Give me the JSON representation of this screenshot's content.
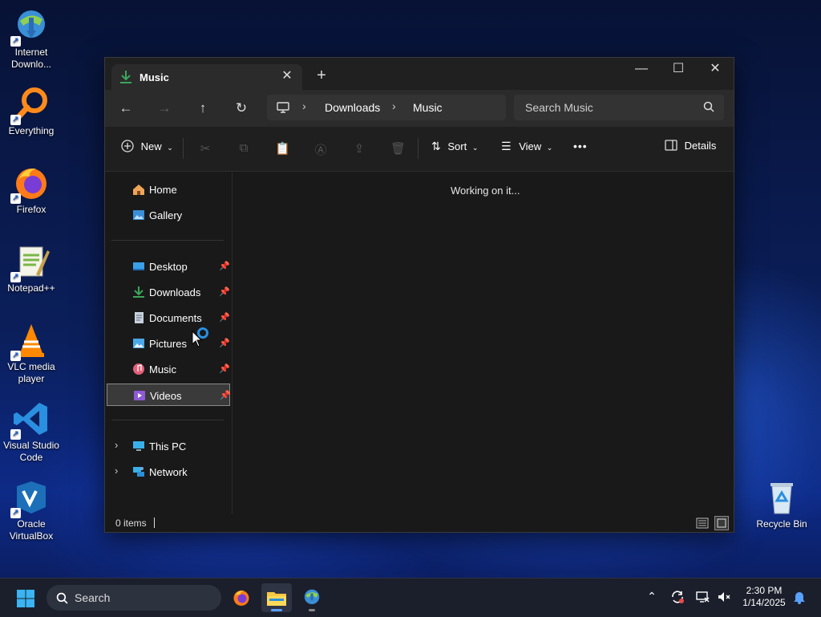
{
  "desktop": {
    "icons": [
      {
        "label": "Internet Downlo...",
        "icon": "idm-icon"
      },
      {
        "label": "Everything",
        "icon": "everything-icon"
      },
      {
        "label": "Firefox",
        "icon": "firefox-icon"
      },
      {
        "label": "Notepad++",
        "icon": "notepadpp-icon"
      },
      {
        "label": "VLC media player",
        "icon": "vlc-icon"
      },
      {
        "label": "Visual Studio Code",
        "icon": "vscode-icon"
      },
      {
        "label": "Oracle VirtualBox",
        "icon": "virtualbox-icon"
      },
      {
        "label": "Recycle Bin",
        "icon": "recycle-bin-icon"
      }
    ]
  },
  "window": {
    "tab_title": "Music",
    "new_tab_symbol": "+",
    "breadcrumb": [
      "Downloads",
      "Music"
    ],
    "search_placeholder": "Search Music",
    "toolbar": {
      "new_label": "New",
      "sort_label": "Sort",
      "view_label": "View",
      "more_label": "•••",
      "details_label": "Details"
    },
    "sidebar": {
      "top": [
        {
          "label": "Home",
          "icon": "home-icon"
        },
        {
          "label": "Gallery",
          "icon": "gallery-icon"
        }
      ],
      "pinned": [
        {
          "label": "Desktop",
          "icon": "desktop-folder-icon"
        },
        {
          "label": "Downloads",
          "icon": "downloads-folder-icon"
        },
        {
          "label": "Documents",
          "icon": "documents-folder-icon"
        },
        {
          "label": "Pictures",
          "icon": "pictures-folder-icon"
        },
        {
          "label": "Music",
          "icon": "music-folder-icon"
        },
        {
          "label": "Videos",
          "icon": "videos-folder-icon",
          "selected": true
        }
      ],
      "bottom": [
        {
          "label": "This PC",
          "icon": "this-pc-icon"
        },
        {
          "label": "Network",
          "icon": "network-icon"
        }
      ]
    },
    "content_status": "Working on it...",
    "status_bar": {
      "items": "0 items"
    }
  },
  "taskbar": {
    "search_placeholder": "Search",
    "clock_time": "2:30 PM",
    "clock_date": "1/14/2025"
  },
  "colors": {
    "window_bg": "#191919",
    "navbar_bg": "#2b2b2b",
    "accent": "#3ca55c",
    "taskbar_bg": "#1b1f2b"
  }
}
